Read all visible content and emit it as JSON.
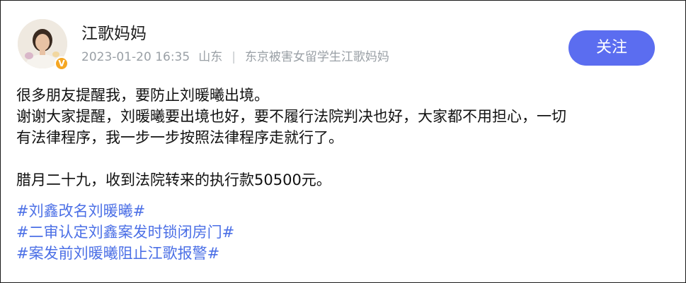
{
  "post": {
    "author": {
      "name": "江歌妈妈",
      "avatar": "avatar",
      "verified_badge": "V"
    },
    "meta": {
      "datetime": "2023-01-20 16:35",
      "location": "山东",
      "separator": "|",
      "description": "东京被害女留学生江歌妈妈"
    },
    "follow_label": "关注",
    "content": {
      "line1": "很多朋友提醒我，要防止刘暖曦出境。",
      "line2": "谢谢大家提醒，刘暖曦要出境也好，要不履行法院判决也好，大家都不用担心，一切",
      "line3": "有法律程序，我一步一步按照法律程序走就行了。",
      "line4": "腊月二十九，收到法院转来的执行款50500元。"
    },
    "tags": [
      "#刘鑫改名刘暖曦#",
      "#二审认定刘鑫案发时锁闭房门#",
      "#案发前刘暖曦阻止江歌报警#"
    ]
  },
  "colors": {
    "follow_button": "#5b6df0",
    "tag": "#4b6fe6",
    "badge": "#f5a623",
    "meta_text": "#9aa0a6"
  }
}
